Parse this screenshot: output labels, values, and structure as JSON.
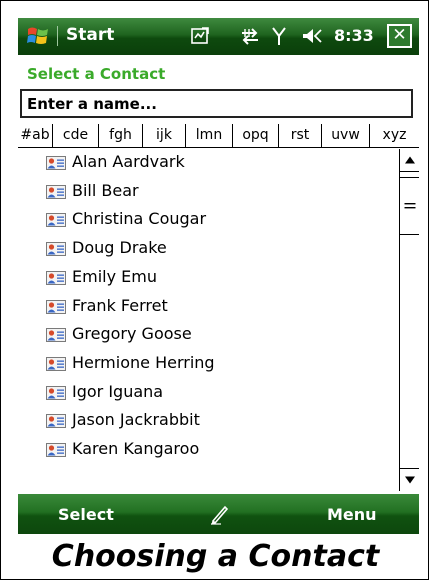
{
  "title_bar": {
    "app_title": "Start",
    "time": "8:33",
    "close_label": "✕",
    "icons": [
      "windows-flag-icon",
      "sync-icon",
      "connectivity-icon",
      "signal-icon",
      "volume-icon"
    ]
  },
  "heading": "Select a Contact",
  "search": {
    "placeholder": "Enter a name...",
    "value": ""
  },
  "tabs": [
    "#ab",
    "cde",
    "fgh",
    "ijk",
    "lmn",
    "opq",
    "rst",
    "uvw",
    "xyz"
  ],
  "contacts": [
    "Alan Aardvark",
    "Bill Bear",
    "Christina Cougar",
    "Doug Drake",
    "Emily Emu",
    "Frank Ferret",
    "Gregory Goose",
    "Hermione Herring",
    "Igor Iguana",
    "Jason Jackrabbit",
    "Karen Kangaroo"
  ],
  "softkeys": {
    "left": "Select",
    "right": "Menu",
    "center_icon": "pen-icon"
  },
  "caption": "Choosing a Contact",
  "colors": {
    "bar_green": "#1f641f",
    "heading_green": "#3aaa2a"
  }
}
